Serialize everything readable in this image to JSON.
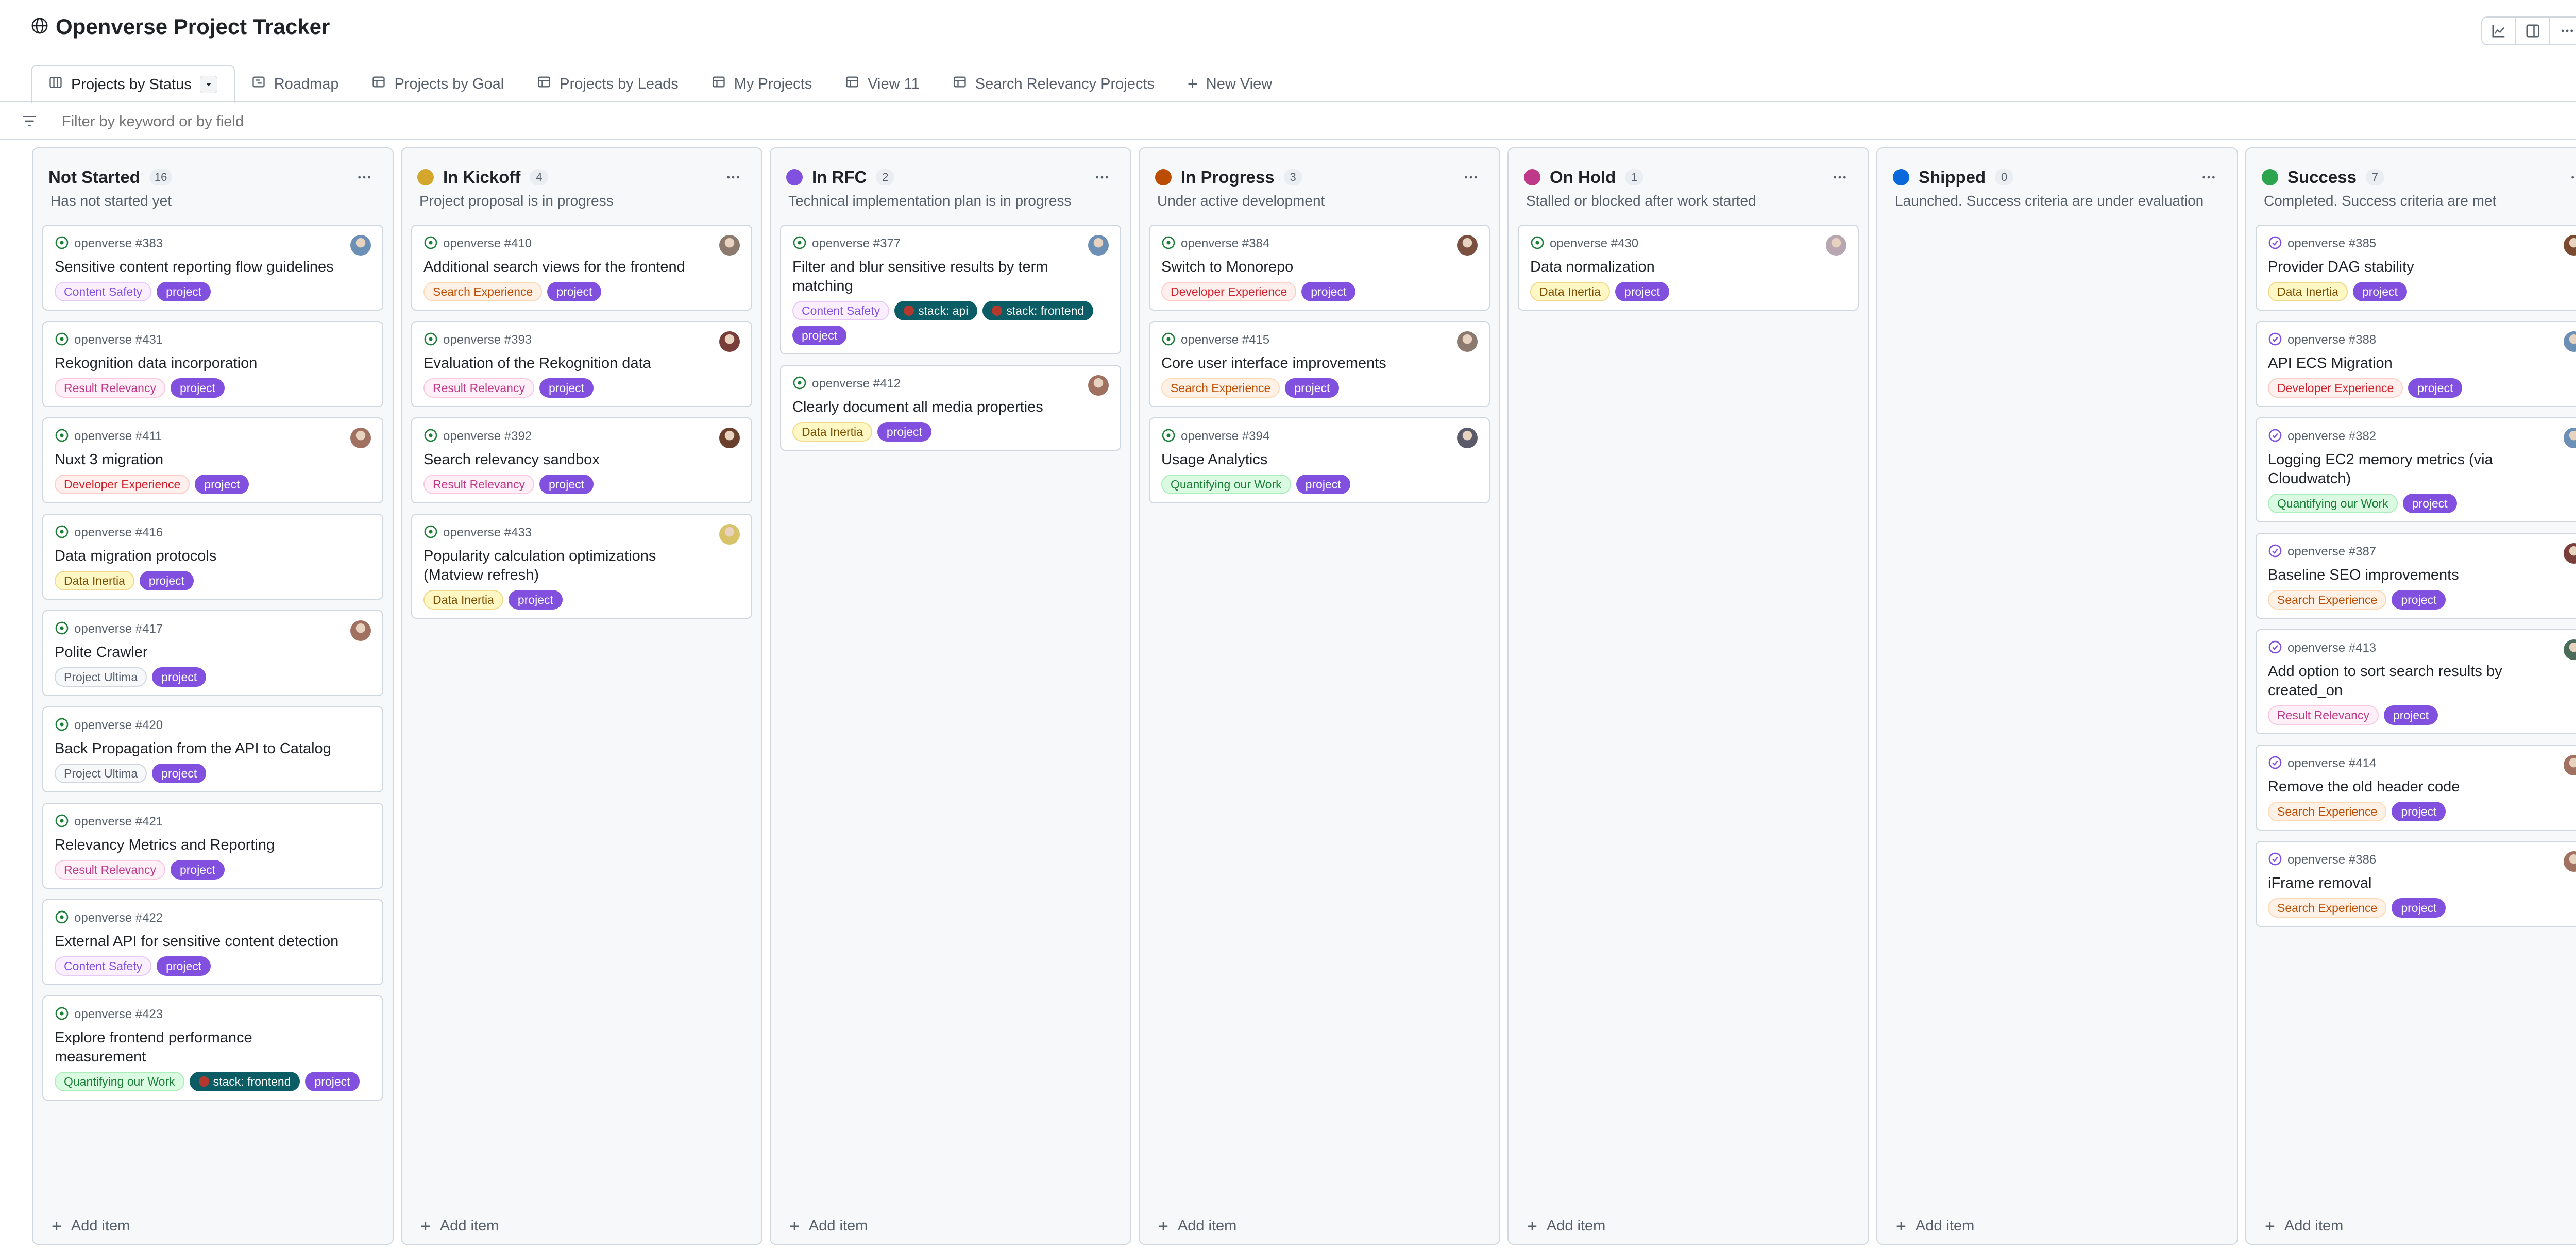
{
  "app": {
    "title": "Openverse Project Tracker"
  },
  "tabs": [
    {
      "label": "Projects by Status",
      "icon": "board-icon",
      "active": true
    },
    {
      "label": "Roadmap",
      "icon": "roadmap-icon"
    },
    {
      "label": "Projects by Goal",
      "icon": "table-icon"
    },
    {
      "label": "Projects by Leads",
      "icon": "table-icon"
    },
    {
      "label": "My Projects",
      "icon": "table-icon"
    },
    {
      "label": "View 11",
      "icon": "table-icon"
    },
    {
      "label": "Search Relevancy Projects",
      "icon": "table-icon"
    }
  ],
  "new_view_label": "New View",
  "filter": {
    "placeholder": "Filter by keyword or by field"
  },
  "add_item_label": "Add item",
  "colors": {
    "not_started": "#ffffff",
    "in_kickoff": "#d4a72c",
    "in_rfc": "#8250df",
    "in_progress": "#bc4c00",
    "on_hold": "#bf3989",
    "shipped": "#0969da",
    "success": "#2da44e",
    "project_label": "#8250df",
    "stack_label": "#0b5c64"
  },
  "columns": [
    {
      "name": "Not Started",
      "count": "16",
      "description": "Has not started yet",
      "dot": "none",
      "cards": [
        {
          "ref": "openverse #383",
          "title": "Sensitive content reporting flow guidelines",
          "labels": [
            {
              "text": "Content Safety",
              "kind": "safety"
            },
            {
              "text": "project",
              "kind": "project"
            }
          ],
          "avatar": "#6b8fb5"
        },
        {
          "ref": "openverse #431",
          "title": "Rekognition data incorporation",
          "labels": [
            {
              "text": "Result Relevancy",
              "kind": "relevancy"
            },
            {
              "text": "project",
              "kind": "project"
            }
          ],
          "avatar": ""
        },
        {
          "ref": "openverse #411",
          "title": "Nuxt 3 migration",
          "labels": [
            {
              "text": "Developer Experience",
              "kind": "devx"
            },
            {
              "text": "project",
              "kind": "project"
            }
          ],
          "avatar": "#a07060"
        },
        {
          "ref": "openverse #416",
          "title": "Data migration protocols",
          "labels": [
            {
              "text": "Data Inertia",
              "kind": "inertia"
            },
            {
              "text": "project",
              "kind": "project"
            }
          ],
          "avatar": ""
        },
        {
          "ref": "openverse #417",
          "title": "Polite Crawler",
          "labels": [
            {
              "text": "Project Ultima",
              "kind": "ultima"
            },
            {
              "text": "project",
              "kind": "project"
            }
          ],
          "avatar": "#a07060"
        },
        {
          "ref": "openverse #420",
          "title": "Back Propagation from the API to Catalog",
          "labels": [
            {
              "text": "Project Ultima",
              "kind": "ultima"
            },
            {
              "text": "project",
              "kind": "project"
            }
          ],
          "avatar": ""
        },
        {
          "ref": "openverse #421",
          "title": "Relevancy Metrics and Reporting",
          "labels": [
            {
              "text": "Result Relevancy",
              "kind": "relevancy"
            },
            {
              "text": "project",
              "kind": "project"
            }
          ],
          "avatar": ""
        },
        {
          "ref": "openverse #422",
          "title": "External API for sensitive content detection",
          "labels": [
            {
              "text": "Content Safety",
              "kind": "safety"
            },
            {
              "text": "project",
              "kind": "project"
            }
          ],
          "avatar": ""
        },
        {
          "ref": "openverse #423",
          "title": "Explore frontend performance measurement",
          "labels": [
            {
              "text": "Quantifying our Work",
              "kind": "quant"
            },
            {
              "text": "stack: frontend",
              "kind": "stack"
            },
            {
              "text": "project",
              "kind": "project"
            }
          ],
          "avatar": ""
        }
      ]
    },
    {
      "name": "In Kickoff",
      "count": "4",
      "description": "Project proposal is in progress",
      "dot": "in_kickoff",
      "cards": [
        {
          "ref": "openverse #410",
          "title": "Additional search views for the frontend",
          "labels": [
            {
              "text": "Search Experience",
              "kind": "search"
            },
            {
              "text": "project",
              "kind": "project"
            }
          ],
          "avatar": "#8d7a6e"
        },
        {
          "ref": "openverse #393",
          "title": "Evaluation of the Rekognition data",
          "labels": [
            {
              "text": "Result Relevancy",
              "kind": "relevancy"
            },
            {
              "text": "project",
              "kind": "project"
            }
          ],
          "avatar": "#7a3e3a"
        },
        {
          "ref": "openverse #392",
          "title": "Search relevancy sandbox",
          "labels": [
            {
              "text": "Result Relevancy",
              "kind": "relevancy"
            },
            {
              "text": "project",
              "kind": "project"
            }
          ],
          "avatar": "#6a3f2c"
        },
        {
          "ref": "openverse #433",
          "title": "Popularity calculation optimizations (Matview refresh)",
          "labels": [
            {
              "text": "Data Inertia",
              "kind": "inertia"
            },
            {
              "text": "project",
              "kind": "project"
            }
          ],
          "avatar": "#d8c36a"
        }
      ]
    },
    {
      "name": "In RFC",
      "count": "2",
      "description": "Technical implementation plan is in progress",
      "dot": "in_rfc",
      "cards": [
        {
          "ref": "openverse #377",
          "title": "Filter and blur sensitive results by term matching",
          "labels": [
            {
              "text": "Content Safety",
              "kind": "safety"
            },
            {
              "text": "stack: api",
              "kind": "stack"
            },
            {
              "text": "stack: frontend",
              "kind": "stack"
            },
            {
              "text": "project",
              "kind": "project"
            }
          ],
          "avatar": "#6b8fb5"
        },
        {
          "ref": "openverse #412",
          "title": "Clearly document all media properties",
          "labels": [
            {
              "text": "Data Inertia",
              "kind": "inertia"
            },
            {
              "text": "project",
              "kind": "project"
            }
          ],
          "avatar": "#a07060"
        }
      ]
    },
    {
      "name": "In Progress",
      "count": "3",
      "description": "Under active development",
      "dot": "in_progress",
      "cards": [
        {
          "ref": "openverse #384",
          "title": "Switch to Monorepo",
          "labels": [
            {
              "text": "Developer Experience",
              "kind": "devx"
            },
            {
              "text": "project",
              "kind": "project"
            }
          ],
          "avatar": "#7a5040"
        },
        {
          "ref": "openverse #415",
          "title": "Core user interface improvements",
          "labels": [
            {
              "text": "Search Experience",
              "kind": "search"
            },
            {
              "text": "project",
              "kind": "project"
            }
          ],
          "avatar": "#8d7a6e"
        },
        {
          "ref": "openverse #394",
          "title": "Usage Analytics",
          "labels": [
            {
              "text": "Quantifying our Work",
              "kind": "quant"
            },
            {
              "text": "project",
              "kind": "project"
            }
          ],
          "avatar": "#5a5a6a"
        }
      ]
    },
    {
      "name": "On Hold",
      "count": "1",
      "description": "Stalled or blocked after work started",
      "dot": "on_hold",
      "cards": [
        {
          "ref": "openverse #430",
          "title": "Data normalization",
          "labels": [
            {
              "text": "Data Inertia",
              "kind": "inertia"
            },
            {
              "text": "project",
              "kind": "project"
            }
          ],
          "avatar": "#b8a6b0"
        }
      ]
    },
    {
      "name": "Shipped",
      "count": "0",
      "description": "Launched. Success criteria are under evaluation",
      "dot": "shipped",
      "cards": []
    },
    {
      "name": "Success",
      "count": "7",
      "description": "Completed. Success criteria are met",
      "dot": "success",
      "cards": [
        {
          "ref": "openverse #385",
          "title": "Provider DAG stability",
          "labels": [
            {
              "text": "Data Inertia",
              "kind": "inertia"
            },
            {
              "text": "project",
              "kind": "project"
            }
          ],
          "avatar": "#7a4a30"
        },
        {
          "ref": "openverse #388",
          "title": "API ECS Migration",
          "labels": [
            {
              "text": "Developer Experience",
              "kind": "devx"
            },
            {
              "text": "project",
              "kind": "project"
            }
          ],
          "avatar": "#6b8fb5"
        },
        {
          "ref": "openverse #382",
          "title": "Logging EC2 memory metrics (via Cloudwatch)",
          "labels": [
            {
              "text": "Quantifying our Work",
              "kind": "quant"
            },
            {
              "text": "project",
              "kind": "project"
            }
          ],
          "avatar": "#6b8fb5"
        },
        {
          "ref": "openverse #387",
          "title": "Baseline SEO improvements",
          "labels": [
            {
              "text": "Search Experience",
              "kind": "search"
            },
            {
              "text": "project",
              "kind": "project"
            }
          ],
          "avatar": "#7a3e3a"
        },
        {
          "ref": "openverse #413",
          "title": "Add option to sort search results by created_on",
          "labels": [
            {
              "text": "Result Relevancy",
              "kind": "relevancy"
            },
            {
              "text": "project",
              "kind": "project"
            }
          ],
          "avatar": "#4a6a5a"
        },
        {
          "ref": "openverse #414",
          "title": "Remove the old header code",
          "labels": [
            {
              "text": "Search Experience",
              "kind": "search"
            },
            {
              "text": "project",
              "kind": "project"
            }
          ],
          "avatar": "#a07060"
        },
        {
          "ref": "openverse #386",
          "title": "iFrame removal",
          "labels": [
            {
              "text": "Search Experience",
              "kind": "search"
            },
            {
              "text": "project",
              "kind": "project"
            }
          ],
          "avatar": "#a07060"
        }
      ]
    }
  ]
}
